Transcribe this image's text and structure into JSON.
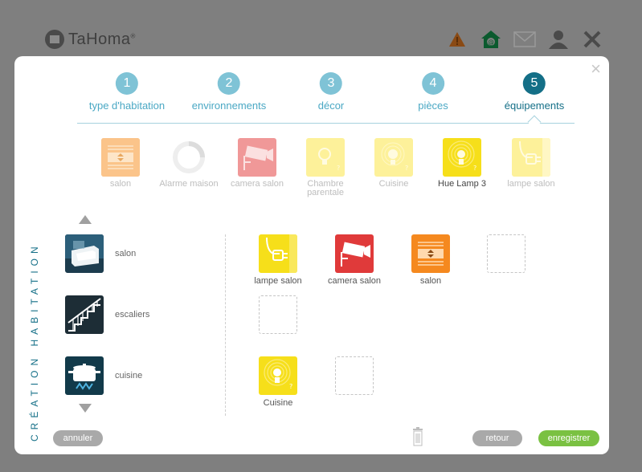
{
  "app": {
    "brand": "TaHoma",
    "brand_mark": "®"
  },
  "header_icons": [
    "warning-icon",
    "home-at-icon",
    "mail-icon",
    "user-icon",
    "close-icon"
  ],
  "modal": {
    "close_glyph": "×",
    "vertical_title": "CRÉATION HABITATION",
    "steps": [
      {
        "num": "1",
        "label": "type d'habitation"
      },
      {
        "num": "2",
        "label": "environnements"
      },
      {
        "num": "3",
        "label": "décor"
      },
      {
        "num": "4",
        "label": "pièces"
      },
      {
        "num": "5",
        "label": "équipements"
      }
    ],
    "active_step": 5,
    "devices": [
      {
        "label": "salon",
        "icon": "shutter-icon"
      },
      {
        "label": "Alarme maison",
        "icon": "alarm-spinner-icon"
      },
      {
        "label": "camera salon",
        "icon": "camera-icon"
      },
      {
        "label": "Chambre parentale",
        "icon": "bulb-icon"
      },
      {
        "label": "Cuisine",
        "icon": "bulb-icon"
      },
      {
        "label": "Hue Lamp 3",
        "icon": "hue-bulb-icon"
      },
      {
        "label": "lampe salon",
        "icon": "plug-icon"
      }
    ],
    "rooms": [
      {
        "label": "salon",
        "icon": "armchair-icon"
      },
      {
        "label": "escaliers",
        "icon": "stairs-icon"
      },
      {
        "label": "cuisine",
        "icon": "cooking-pot-icon"
      }
    ],
    "placed": {
      "salon": [
        "lampe salon",
        "camera salon",
        "salon"
      ],
      "cuisine": [
        "Cuisine"
      ]
    },
    "buttons": {
      "cancel": "annuler",
      "back": "retour",
      "save": "enregistrer"
    }
  },
  "colors": {
    "accent": "#146f87",
    "step_inactive": "#7fc3d6",
    "save": "#7ac142",
    "yellow": "#f6df1a",
    "orange": "#f5891f",
    "red": "#e03a3a"
  }
}
